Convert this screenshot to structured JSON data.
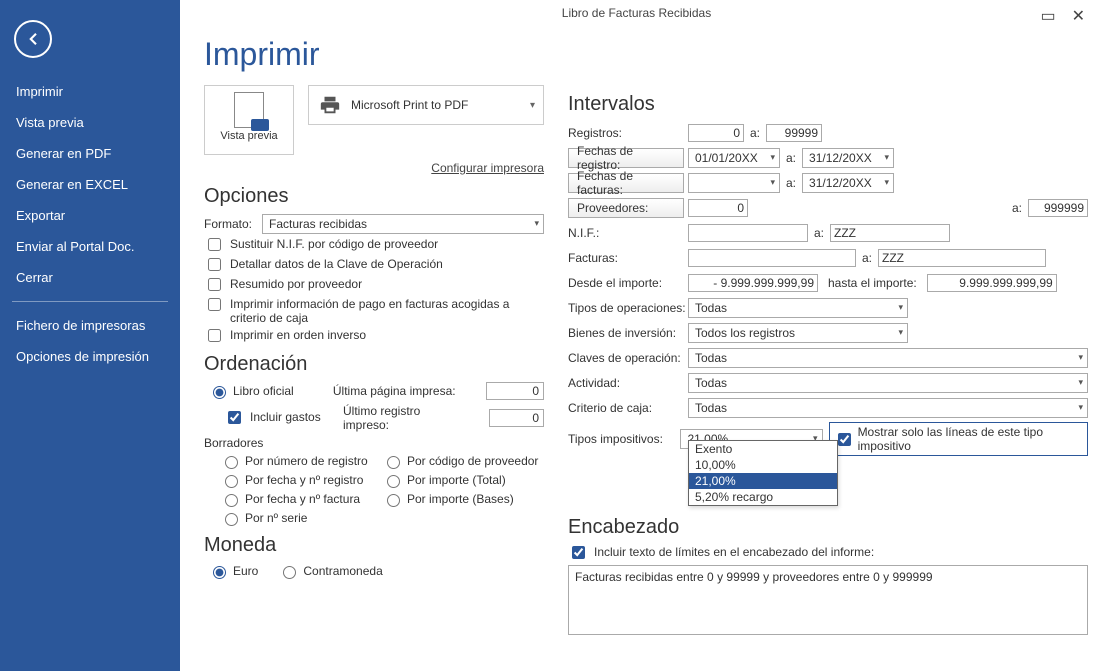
{
  "window": {
    "title": "Libro de Facturas Recibidas"
  },
  "sidebar": {
    "items": [
      "Imprimir",
      "Vista previa",
      "Generar en PDF",
      "Generar en EXCEL",
      "Exportar",
      "Enviar al Portal Doc.",
      "Cerrar"
    ],
    "items2": [
      "Fichero de impresoras",
      "Opciones de impresión"
    ]
  },
  "page": {
    "title": "Imprimir"
  },
  "preview": {
    "label": "Vista previa",
    "printer": "Microsoft Print to PDF",
    "config_link": "Configurar impresora"
  },
  "sections": {
    "opciones": "Opciones",
    "ordenacion": "Ordenación",
    "moneda": "Moneda",
    "intervalos": "Intervalos",
    "encabezado": "Encabezado"
  },
  "opciones": {
    "formato_lbl": "Formato:",
    "formato_val": "Facturas recibidas",
    "chk1": "Sustituir N.I.F. por código de proveedor",
    "chk2": "Detallar datos de la Clave de Operación",
    "chk3": "Resumido por proveedor",
    "chk4": "Imprimir información de pago en facturas acogidas a criterio de caja",
    "chk5": "Imprimir en orden inverso"
  },
  "orden": {
    "r_libro": "Libro oficial",
    "incluir": "Incluir gastos",
    "ultima_pag": "Última página impresa:",
    "ultima_pag_v": "0",
    "ultimo_reg": "Último registro impreso:",
    "ultimo_reg_v": "0",
    "borradores": "Borradores",
    "r1": "Por número de registro",
    "r2": "Por código de proveedor",
    "r3": "Por fecha y nº registro",
    "r4": "Por importe (Total)",
    "r5": "Por fecha y nº factura",
    "r6": "Por importe (Bases)",
    "r7": "Por nº serie"
  },
  "moneda": {
    "euro": "Euro",
    "contra": "Contramoneda"
  },
  "intervalos": {
    "registros_lbl": "Registros:",
    "reg_from": "0",
    "reg_to": "99999",
    "fechas_reg_btn": "Fechas de registro:",
    "freg_from": "01/01/20XX",
    "freg_to": "31/12/20XX",
    "fechas_fac_btn": "Fechas de facturas:",
    "ffac_from": "",
    "ffac_to": "31/12/20XX",
    "prov_btn": "Proveedores:",
    "prov_from": "0",
    "prov_to": "999999",
    "nif_lbl": "N.I.F.:",
    "nif_from": "",
    "nif_to": "ZZZ",
    "fact_lbl": "Facturas:",
    "fact_from": "",
    "fact_to": "ZZZ",
    "desde_imp": "Desde el importe:",
    "desde_v": "-     9.999.999.999,99",
    "hasta_imp": "hasta el importe:",
    "hasta_v": "9.999.999.999,99",
    "tipos_op_lbl": "Tipos de operaciones:",
    "tipos_op_v": "Todas",
    "bienes_lbl": "Bienes de inversión:",
    "bienes_v": "Todos los registros",
    "claves_lbl": "Claves de operación:",
    "claves_v": "Todas",
    "actividad_lbl": "Actividad:",
    "actividad_v": "Todas",
    "criterio_lbl": "Criterio de caja:",
    "criterio_v": "Todas",
    "tipos_imp_lbl": "Tipos impositivos:",
    "tipos_imp_v": "21,00%",
    "mostrar_chk": "Mostrar solo las líneas de este tipo impositivo",
    "a": "a:",
    "dropdown": [
      "Exento",
      "10,00%",
      "21,00%",
      "5,20% recargo"
    ],
    "dropdown_selected": 2
  },
  "encabezado": {
    "chk": "Incluir texto de límites en el encabezado del informe:",
    "text": "Facturas recibidas entre 0 y 99999 y proveedores entre 0 y 999999"
  }
}
